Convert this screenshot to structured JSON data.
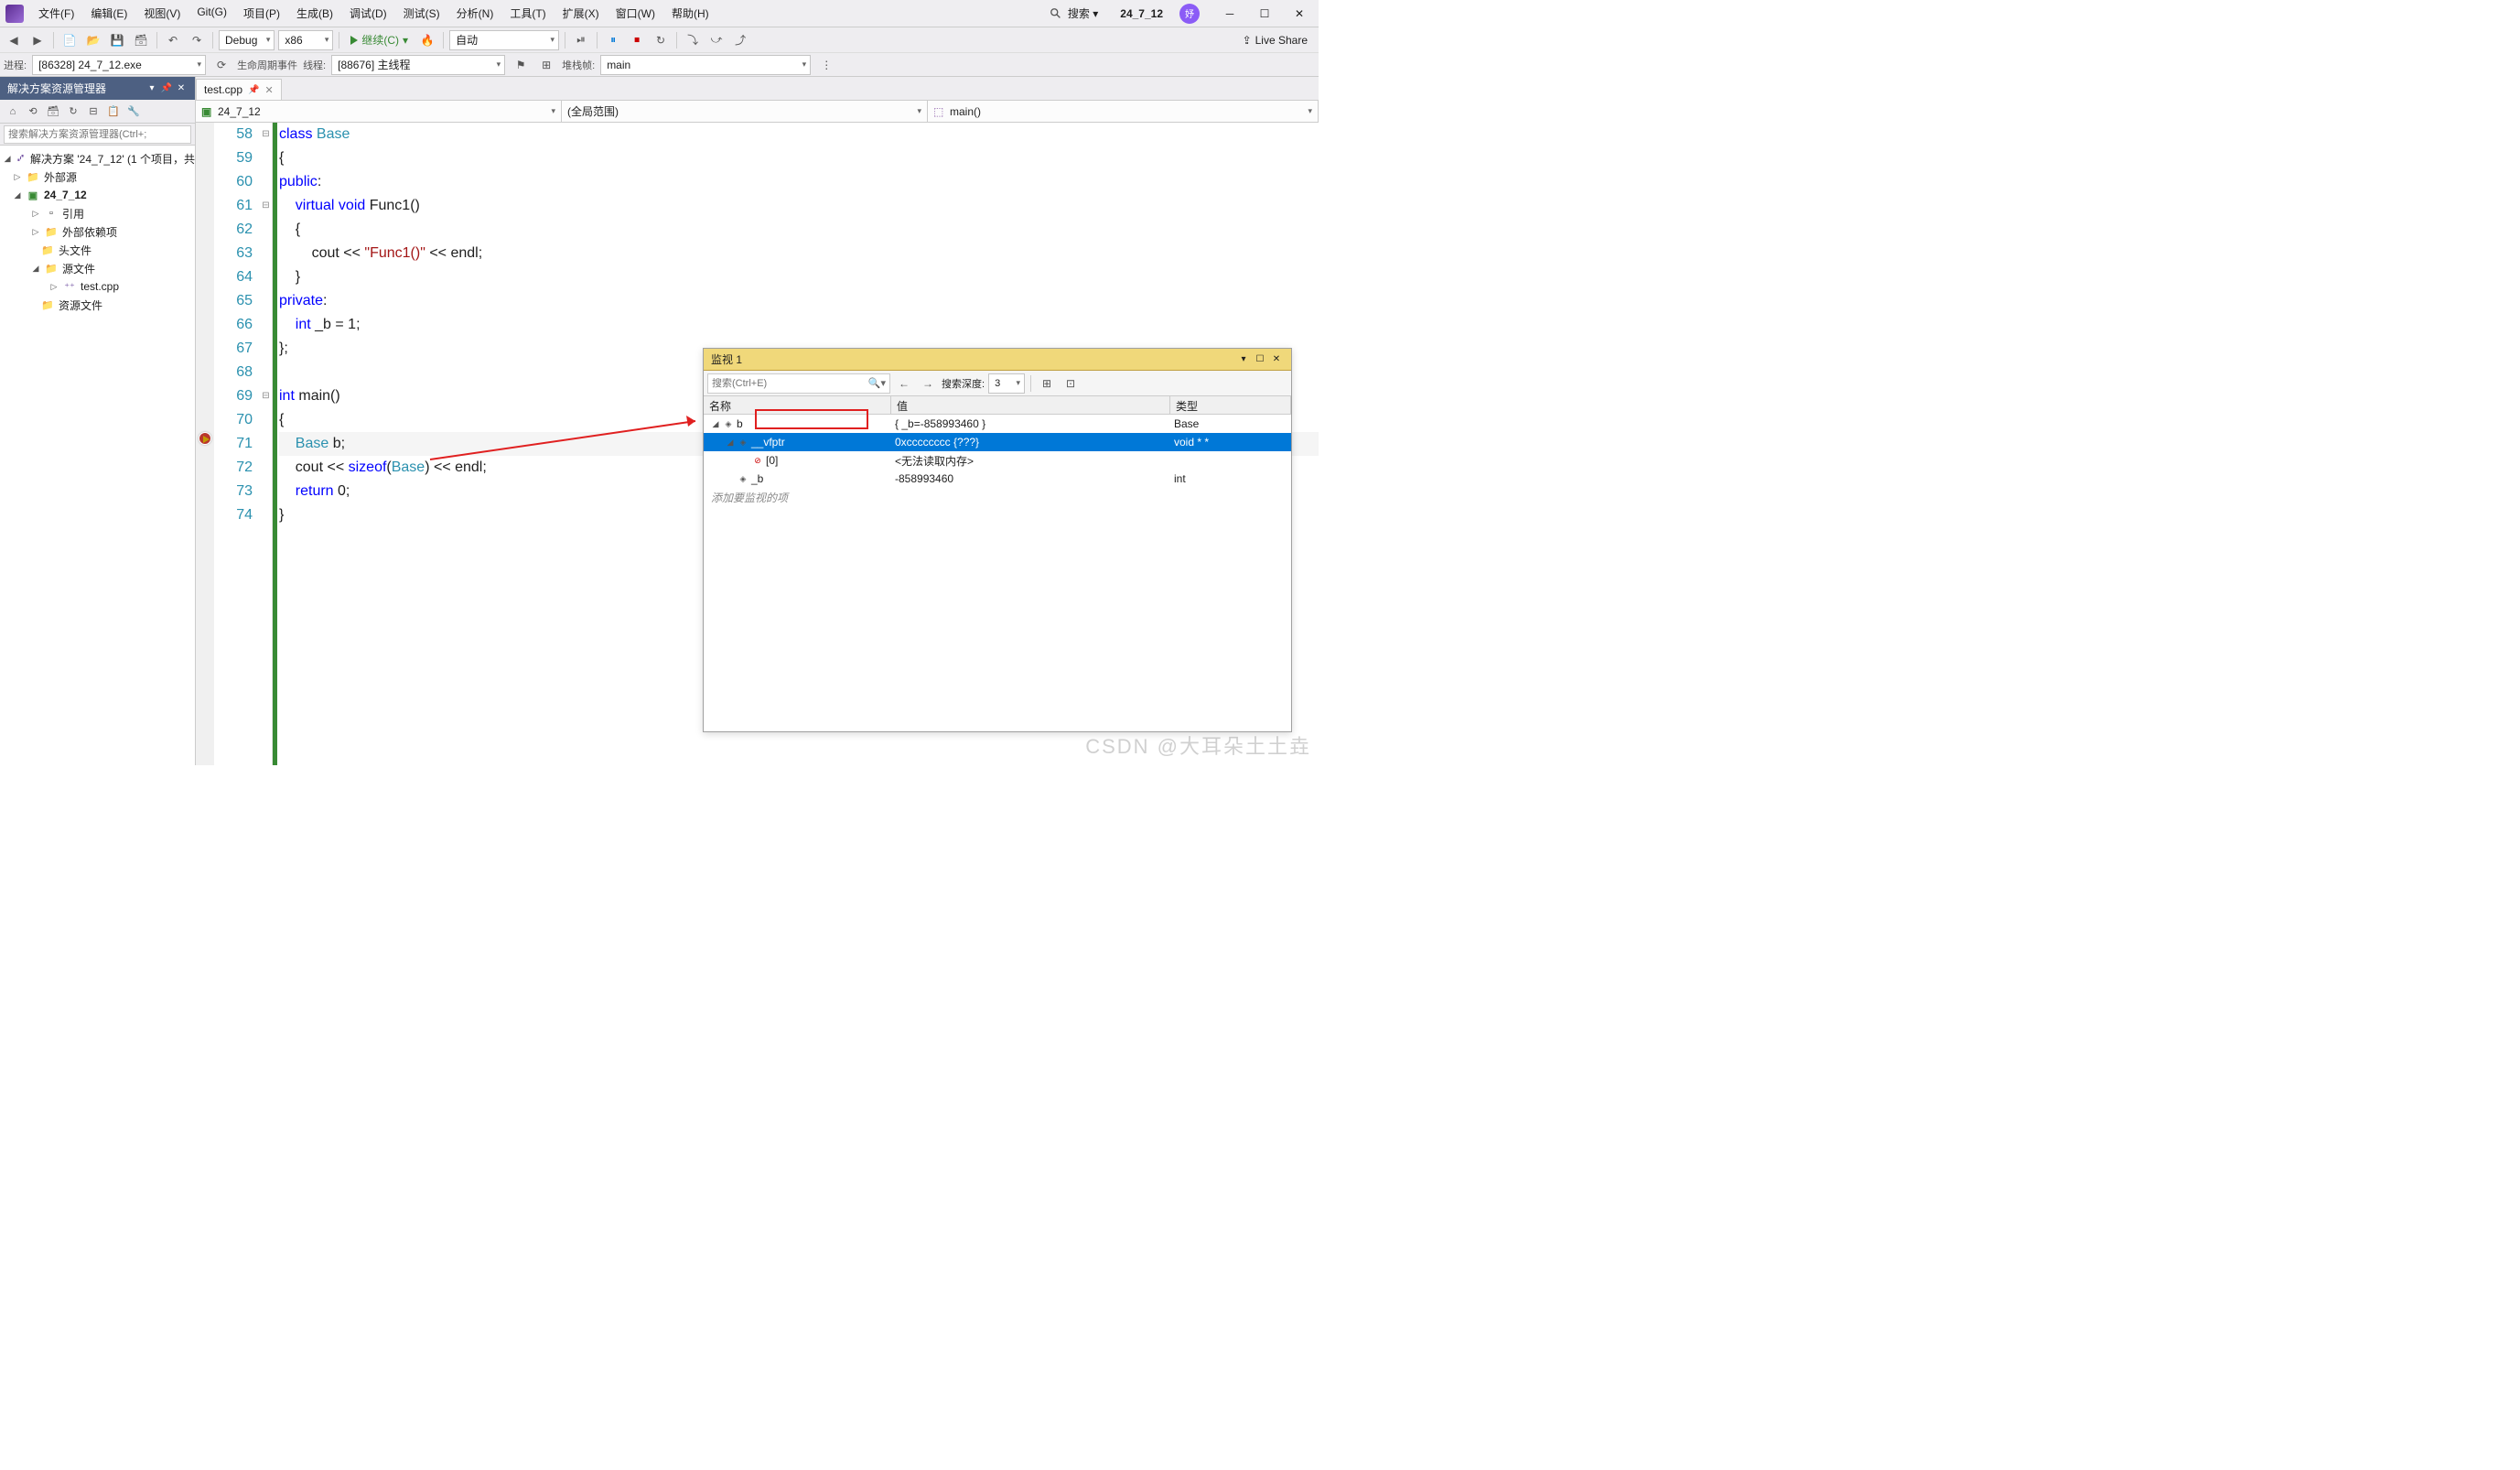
{
  "menu": {
    "file": "文件(F)",
    "edit": "编辑(E)",
    "view": "视图(V)",
    "git": "Git(G)",
    "project": "项目(P)",
    "build": "生成(B)",
    "debug": "调试(D)",
    "test": "测试(S)",
    "analyze": "分析(N)",
    "tools": "工具(T)",
    "extensions": "扩展(X)",
    "window": "窗口(W)",
    "help": "帮助(H)"
  },
  "titlebar": {
    "search": "搜索 ▾",
    "project": "24_7_12"
  },
  "toolbar": {
    "config": "Debug",
    "platform": "x86",
    "continue": "继续(C)",
    "auto": "自动",
    "live_share": "Live Share"
  },
  "toolbar2": {
    "process_label": "进程:",
    "process": "[86328] 24_7_12.exe",
    "lifecycle": "生命周期事件",
    "thread_label": "线程:",
    "thread": "[88676] 主线程",
    "stack_label": "堆栈帧:",
    "stack": "main"
  },
  "sidebar": {
    "title": "解决方案资源管理器",
    "search_ph": "搜索解决方案资源管理器(Ctrl+;",
    "solution": "解决方案 '24_7_12' (1 个项目，共",
    "project": "24_7_12",
    "ext_src": "外部源",
    "refs": "引用",
    "ext_deps": "外部依赖项",
    "headers": "头文件",
    "sources": "源文件",
    "test_cpp": "test.cpp",
    "resources": "资源文件"
  },
  "tab": {
    "name": "test.cpp"
  },
  "navbar": {
    "project": "24_7_12",
    "scope": "(全局范围)",
    "func": "main()"
  },
  "code": {
    "lines": [
      {
        "n": 58,
        "fold": "⊟",
        "html": "<span class='kw'>class</span> <span class='type'>Base</span>"
      },
      {
        "n": 59,
        "fold": "",
        "html": "{"
      },
      {
        "n": 60,
        "fold": "",
        "html": "<span class='kw'>public</span>:"
      },
      {
        "n": 61,
        "fold": "⊟",
        "html": "    <span class='kw'>virtual</span> <span class='kw'>void</span> <span class=''>Func1</span>()"
      },
      {
        "n": 62,
        "fold": "",
        "html": "    {"
      },
      {
        "n": 63,
        "fold": "",
        "html": "        cout &lt;&lt; <span class='str'>\"Func1()\"</span> &lt;&lt; endl;"
      },
      {
        "n": 64,
        "fold": "",
        "html": "    }"
      },
      {
        "n": 65,
        "fold": "",
        "html": "<span class='kw'>private</span>:"
      },
      {
        "n": 66,
        "fold": "",
        "html": "    <span class='kw'>int</span> _b = 1;"
      },
      {
        "n": 67,
        "fold": "",
        "html": "};"
      },
      {
        "n": 68,
        "fold": "",
        "html": ""
      },
      {
        "n": 69,
        "fold": "⊟",
        "html": "<span class='kw'>int</span> <span class=''>main</span>()"
      },
      {
        "n": 70,
        "fold": "",
        "html": "{"
      },
      {
        "n": 71,
        "fold": "",
        "html": "    <span class='type'>Base</span> b;",
        "bp": true,
        "cur": true
      },
      {
        "n": 72,
        "fold": "",
        "html": "    cout &lt;&lt; <span class='kw'>sizeof</span>(<span class='type'>Base</span>) &lt;&lt; endl;"
      },
      {
        "n": 73,
        "fold": "",
        "html": "    <span class='kw'>return</span> 0;"
      },
      {
        "n": 74,
        "fold": "",
        "html": "}"
      }
    ]
  },
  "watch": {
    "title": "监视 1",
    "search_ph": "搜索(Ctrl+E)",
    "depth_label": "搜索深度:",
    "depth_val": "3",
    "cols": {
      "name": "名称",
      "value": "值",
      "type": "类型"
    },
    "rows": [
      {
        "indent": 0,
        "tw": "◢",
        "icon": "obj",
        "name": "b",
        "val": "{ _b=-858993460 }",
        "type": "Base"
      },
      {
        "indent": 1,
        "tw": "◢",
        "icon": "obj",
        "name": "__vfptr",
        "val": "0xcccccccc {???}",
        "type": "void * *",
        "sel": true,
        "box": true
      },
      {
        "indent": 2,
        "tw": "",
        "icon": "err",
        "name": "[0]",
        "val": "<无法读取内存>",
        "type": ""
      },
      {
        "indent": 1,
        "tw": "",
        "icon": "obj",
        "name": "_b",
        "val": "-858993460",
        "type": "int"
      }
    ],
    "add_prompt": "添加要监视的项"
  },
  "watermark": "CSDN @大耳朵土土垚"
}
